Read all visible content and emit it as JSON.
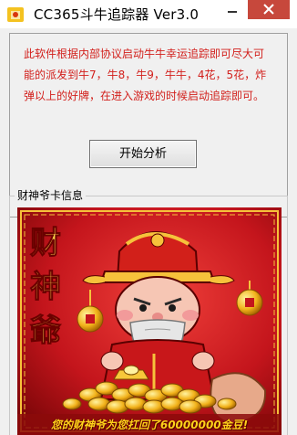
{
  "window": {
    "title": "CC365斗牛追踪器 Ver3.0"
  },
  "description": {
    "text": "此软件根据内部协议启动牛牛幸运追踪即可尽大可能的派发到牛7，牛8，牛9，牛牛，4花，5花，炸弹以上的好牌，在进入游戏的时候启动追踪即可。"
  },
  "buttons": {
    "analyze_label": "开始分析"
  },
  "card_info": {
    "group_label": "财神爷卡信息",
    "artwork": {
      "vertical_text": [
        "财",
        "神",
        "爺"
      ],
      "caption": "您的财神爷为您扛回了60000000金豆!"
    }
  },
  "colors": {
    "description_text": "#d21f1b",
    "close_button": "#c7483c",
    "card_background": "#c4151c",
    "caption_gold": "#ffd21a"
  }
}
